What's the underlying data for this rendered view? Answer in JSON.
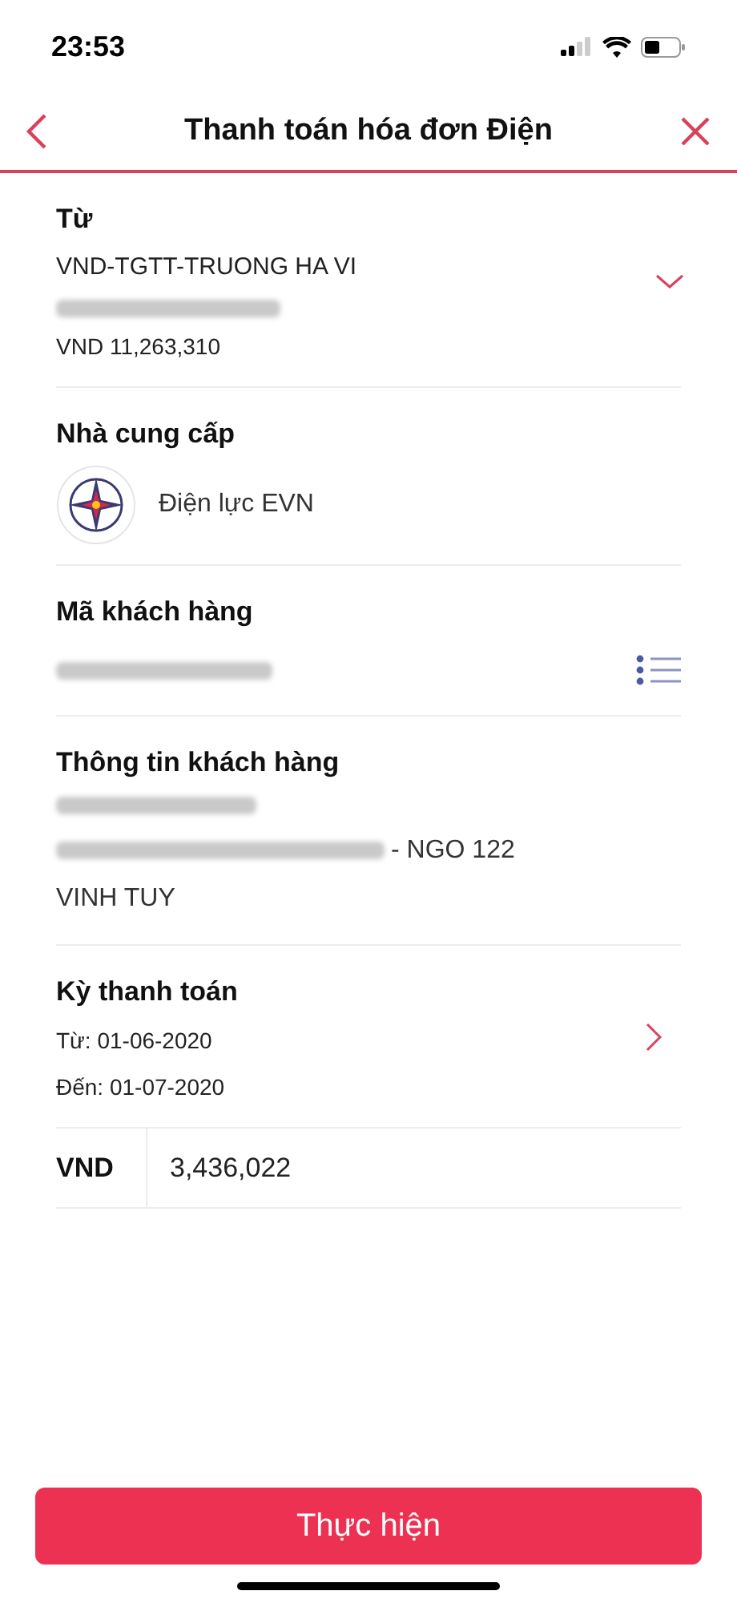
{
  "status_bar": {
    "time": "23:53"
  },
  "header": {
    "title": "Thanh toán hóa đơn Điện"
  },
  "from": {
    "label": "Từ",
    "account_name": "VND-TGTT-TRUONG HA VI",
    "account_number": {
      "kind": "blurred"
    },
    "balance": "VND 11,263,310"
  },
  "provider": {
    "label": "Nhà cung cấp",
    "name": "Điện lực EVN"
  },
  "customer_code": {
    "label": "Mã khách hàng",
    "value": {
      "kind": "blurred"
    }
  },
  "customer_info": {
    "label": "Thông tin khách hàng",
    "lines": [
      [
        {
          "kind": "blurred"
        }
      ],
      [
        {
          "kind": "blurred"
        },
        {
          "kind": "text",
          "text": "- NGO 122"
        }
      ],
      [
        {
          "kind": "text",
          "text": "VINH TUY"
        }
      ]
    ]
  },
  "billing_period": {
    "label": "Kỳ thanh toán",
    "from": "Từ: 01-06-2020",
    "to": "Đến: 01-07-2020"
  },
  "amount": {
    "currency": "VND",
    "value": "3,436,022"
  },
  "submit_button": {
    "label": "Thực hiện"
  }
}
